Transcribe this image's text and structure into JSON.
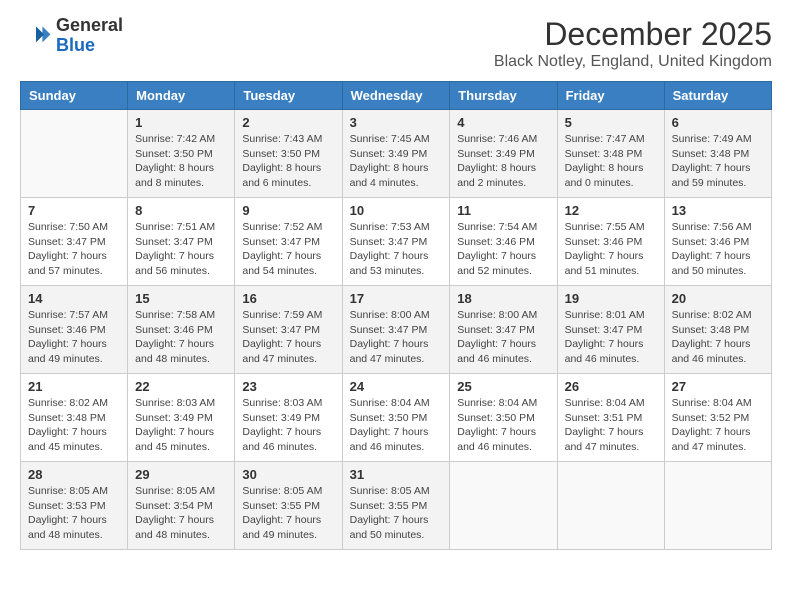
{
  "logo": {
    "general": "General",
    "blue": "Blue"
  },
  "header": {
    "month_year": "December 2025",
    "location": "Black Notley, England, United Kingdom"
  },
  "days_of_week": [
    "Sunday",
    "Monday",
    "Tuesday",
    "Wednesday",
    "Thursday",
    "Friday",
    "Saturday"
  ],
  "weeks": [
    [
      {
        "day": "",
        "sunrise": "",
        "sunset": "",
        "daylight": ""
      },
      {
        "day": "1",
        "sunrise": "Sunrise: 7:42 AM",
        "sunset": "Sunset: 3:50 PM",
        "daylight": "Daylight: 8 hours and 8 minutes."
      },
      {
        "day": "2",
        "sunrise": "Sunrise: 7:43 AM",
        "sunset": "Sunset: 3:50 PM",
        "daylight": "Daylight: 8 hours and 6 minutes."
      },
      {
        "day": "3",
        "sunrise": "Sunrise: 7:45 AM",
        "sunset": "Sunset: 3:49 PM",
        "daylight": "Daylight: 8 hours and 4 minutes."
      },
      {
        "day": "4",
        "sunrise": "Sunrise: 7:46 AM",
        "sunset": "Sunset: 3:49 PM",
        "daylight": "Daylight: 8 hours and 2 minutes."
      },
      {
        "day": "5",
        "sunrise": "Sunrise: 7:47 AM",
        "sunset": "Sunset: 3:48 PM",
        "daylight": "Daylight: 8 hours and 0 minutes."
      },
      {
        "day": "6",
        "sunrise": "Sunrise: 7:49 AM",
        "sunset": "Sunset: 3:48 PM",
        "daylight": "Daylight: 7 hours and 59 minutes."
      }
    ],
    [
      {
        "day": "7",
        "sunrise": "Sunrise: 7:50 AM",
        "sunset": "Sunset: 3:47 PM",
        "daylight": "Daylight: 7 hours and 57 minutes."
      },
      {
        "day": "8",
        "sunrise": "Sunrise: 7:51 AM",
        "sunset": "Sunset: 3:47 PM",
        "daylight": "Daylight: 7 hours and 56 minutes."
      },
      {
        "day": "9",
        "sunrise": "Sunrise: 7:52 AM",
        "sunset": "Sunset: 3:47 PM",
        "daylight": "Daylight: 7 hours and 54 minutes."
      },
      {
        "day": "10",
        "sunrise": "Sunrise: 7:53 AM",
        "sunset": "Sunset: 3:47 PM",
        "daylight": "Daylight: 7 hours and 53 minutes."
      },
      {
        "day": "11",
        "sunrise": "Sunrise: 7:54 AM",
        "sunset": "Sunset: 3:46 PM",
        "daylight": "Daylight: 7 hours and 52 minutes."
      },
      {
        "day": "12",
        "sunrise": "Sunrise: 7:55 AM",
        "sunset": "Sunset: 3:46 PM",
        "daylight": "Daylight: 7 hours and 51 minutes."
      },
      {
        "day": "13",
        "sunrise": "Sunrise: 7:56 AM",
        "sunset": "Sunset: 3:46 PM",
        "daylight": "Daylight: 7 hours and 50 minutes."
      }
    ],
    [
      {
        "day": "14",
        "sunrise": "Sunrise: 7:57 AM",
        "sunset": "Sunset: 3:46 PM",
        "daylight": "Daylight: 7 hours and 49 minutes."
      },
      {
        "day": "15",
        "sunrise": "Sunrise: 7:58 AM",
        "sunset": "Sunset: 3:46 PM",
        "daylight": "Daylight: 7 hours and 48 minutes."
      },
      {
        "day": "16",
        "sunrise": "Sunrise: 7:59 AM",
        "sunset": "Sunset: 3:47 PM",
        "daylight": "Daylight: 7 hours and 47 minutes."
      },
      {
        "day": "17",
        "sunrise": "Sunrise: 8:00 AM",
        "sunset": "Sunset: 3:47 PM",
        "daylight": "Daylight: 7 hours and 47 minutes."
      },
      {
        "day": "18",
        "sunrise": "Sunrise: 8:00 AM",
        "sunset": "Sunset: 3:47 PM",
        "daylight": "Daylight: 7 hours and 46 minutes."
      },
      {
        "day": "19",
        "sunrise": "Sunrise: 8:01 AM",
        "sunset": "Sunset: 3:47 PM",
        "daylight": "Daylight: 7 hours and 46 minutes."
      },
      {
        "day": "20",
        "sunrise": "Sunrise: 8:02 AM",
        "sunset": "Sunset: 3:48 PM",
        "daylight": "Daylight: 7 hours and 46 minutes."
      }
    ],
    [
      {
        "day": "21",
        "sunrise": "Sunrise: 8:02 AM",
        "sunset": "Sunset: 3:48 PM",
        "daylight": "Daylight: 7 hours and 45 minutes."
      },
      {
        "day": "22",
        "sunrise": "Sunrise: 8:03 AM",
        "sunset": "Sunset: 3:49 PM",
        "daylight": "Daylight: 7 hours and 45 minutes."
      },
      {
        "day": "23",
        "sunrise": "Sunrise: 8:03 AM",
        "sunset": "Sunset: 3:49 PM",
        "daylight": "Daylight: 7 hours and 46 minutes."
      },
      {
        "day": "24",
        "sunrise": "Sunrise: 8:04 AM",
        "sunset": "Sunset: 3:50 PM",
        "daylight": "Daylight: 7 hours and 46 minutes."
      },
      {
        "day": "25",
        "sunrise": "Sunrise: 8:04 AM",
        "sunset": "Sunset: 3:50 PM",
        "daylight": "Daylight: 7 hours and 46 minutes."
      },
      {
        "day": "26",
        "sunrise": "Sunrise: 8:04 AM",
        "sunset": "Sunset: 3:51 PM",
        "daylight": "Daylight: 7 hours and 47 minutes."
      },
      {
        "day": "27",
        "sunrise": "Sunrise: 8:04 AM",
        "sunset": "Sunset: 3:52 PM",
        "daylight": "Daylight: 7 hours and 47 minutes."
      }
    ],
    [
      {
        "day": "28",
        "sunrise": "Sunrise: 8:05 AM",
        "sunset": "Sunset: 3:53 PM",
        "daylight": "Daylight: 7 hours and 48 minutes."
      },
      {
        "day": "29",
        "sunrise": "Sunrise: 8:05 AM",
        "sunset": "Sunset: 3:54 PM",
        "daylight": "Daylight: 7 hours and 48 minutes."
      },
      {
        "day": "30",
        "sunrise": "Sunrise: 8:05 AM",
        "sunset": "Sunset: 3:55 PM",
        "daylight": "Daylight: 7 hours and 49 minutes."
      },
      {
        "day": "31",
        "sunrise": "Sunrise: 8:05 AM",
        "sunset": "Sunset: 3:55 PM",
        "daylight": "Daylight: 7 hours and 50 minutes."
      },
      {
        "day": "",
        "sunrise": "",
        "sunset": "",
        "daylight": ""
      },
      {
        "day": "",
        "sunrise": "",
        "sunset": "",
        "daylight": ""
      },
      {
        "day": "",
        "sunrise": "",
        "sunset": "",
        "daylight": ""
      }
    ]
  ]
}
